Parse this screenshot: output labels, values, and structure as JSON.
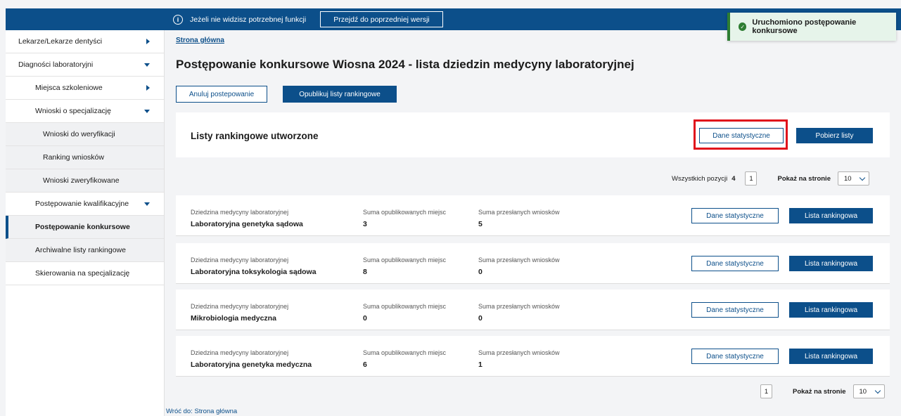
{
  "topbar": {
    "info_text": "Jeżeli nie widzisz potrzebnej funkcji",
    "prev_version_label": "Przejdź do poprzedniej wersji"
  },
  "toast": {
    "message": "Uruchomiono postępowanie konkursowe"
  },
  "sidebar": {
    "items": [
      {
        "label": "Lekarze/Lekarze dentyści"
      },
      {
        "label": "Diagności laboratoryjni"
      },
      {
        "label": "Miejsca szkoleniowe"
      },
      {
        "label": "Wnioski o specjalizację"
      },
      {
        "label": "Wnioski do weryfikacji"
      },
      {
        "label": "Ranking wniosków"
      },
      {
        "label": "Wnioski zweryfikowane"
      },
      {
        "label": "Postępowanie kwalifikacyjne"
      },
      {
        "label": "Postępowanie konkursowe"
      },
      {
        "label": "Archiwalne listy rankingowe"
      },
      {
        "label": "Skierowania na specjalizację"
      }
    ]
  },
  "breadcrumb": "Strona główna",
  "page_title": "Postępowanie konkursowe Wiosna 2024 - lista dziedzin medycyny laboratoryjnej",
  "actions": {
    "cancel_label": "Anuluj postepowanie",
    "publish_label": "Opublikuj listy rankingowe"
  },
  "ranked_card": {
    "title": "Listy rankingowe utworzone",
    "stats_label": "Dane statystyczne",
    "download_label": "Pobierz listy"
  },
  "pager": {
    "total_label": "Wszystkich pozycji",
    "total_count": "4",
    "page": "1",
    "per_page_label": "Pokaż na stronie",
    "per_page": "10"
  },
  "columns": {
    "field": "Dziedzina medycyny laboratoryjnej",
    "published": "Suma opublikowanych miejsc",
    "sent": "Suma przesłanych wniosków"
  },
  "row_buttons": {
    "stats": "Dane statystyczne",
    "ranking": "Lista rankingowa"
  },
  "rows": [
    {
      "field": "Laboratoryjna genetyka sądowa",
      "published": "3",
      "sent": "5"
    },
    {
      "field": "Laboratoryjna toksykologia sądowa",
      "published": "8",
      "sent": "0"
    },
    {
      "field": "Mikrobiologia medyczna",
      "published": "0",
      "sent": "0"
    },
    {
      "field": "Laboratoryjna genetyka medyczna",
      "published": "6",
      "sent": "1"
    }
  ],
  "back_link": "Wróć do: Strona główna"
}
